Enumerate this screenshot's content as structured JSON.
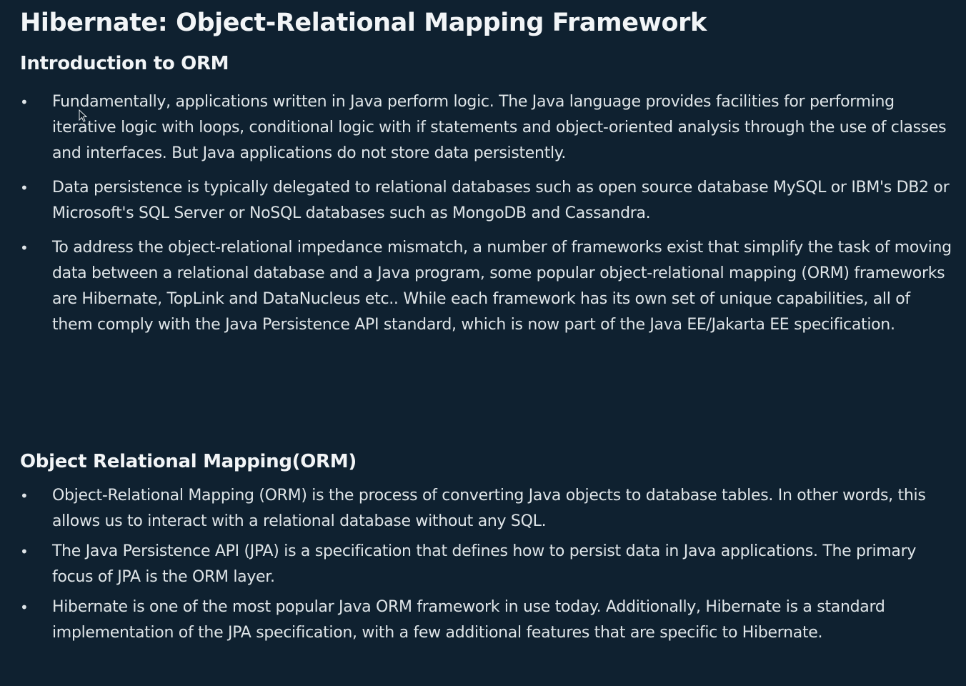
{
  "title": "Hibernate: Object-Relational Mapping Framework",
  "sections": [
    {
      "heading": "Introduction to ORM",
      "items": [
        "Fundamentally, applications written in Java perform logic. The Java language provides facilities for performing iterative logic with loops, conditional logic with if statements and object-oriented analysis through the use of classes and interfaces. But Java applications do not store data persistently.",
        "Data persistence is typically delegated to relational databases such as open source database MySQL or IBM's DB2 or Microsoft's SQL Server or NoSQL databases such as MongoDB and Cassandra.",
        "To address the object-relational impedance mismatch, a number of frameworks exist that simplify the task of moving data between a relational database and a Java program, some popular object-relational mapping (ORM) frameworks are Hibernate, TopLink and DataNucleus etc.. While each framework has its own set of unique capabilities, all of them comply with the Java Persistence API standard, which is now part of the Java EE/Jakarta EE specification."
      ]
    },
    {
      "heading": "Object Relational Mapping(ORM)",
      "items": [
        "Object-Relational Mapping (ORM) is the process of converting Java objects to database tables. In other words, this allows us to interact with a relational database without any SQL.",
        "The Java Persistence API (JPA) is a specification that defines how to persist data in Java applications. The primary focus of JPA is the ORM layer.",
        "Hibernate is one of the most popular Java ORM framework in use today. Additionally, Hibernate is a standard implementation of the JPA specification, with a few additional features that are specific to Hibernate."
      ]
    }
  ],
  "bullet_glyph": "•",
  "colors": {
    "background": "#0f2130",
    "text": "#dfe5e8",
    "heading": "#f2f5f7"
  }
}
